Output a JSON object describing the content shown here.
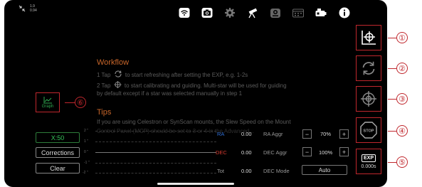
{
  "status": {
    "line1": "1.9",
    "line2": "0.94"
  },
  "topbar_icons": [
    "wifi-icon",
    "camera-icon",
    "gear-icon",
    "telescope-icon",
    "guide-camera-icon",
    "calendar-icon",
    "focuser-icon",
    "info-icon"
  ],
  "workflow": {
    "title": "Workflow",
    "step1_pre": "1 Tap",
    "step1_post": "to start refreshing after setting the EXP, e.g. 1-2s",
    "step2_pre": "2 Tap",
    "step2_post": "to start calibrating and guiding. Multi-star will be used for guiding",
    "step2_line2": "by default except if a star was selected manually in step 1"
  },
  "tips": {
    "title": "Tips",
    "line1": "If you are using Celestron or SynScan mounts, the Slew Speed on the Mount",
    "line2": "Control Panel (MCP) should be set to 3 or 4 in the Advanced..."
  },
  "graph_button": {
    "label": "Graph"
  },
  "left_buttons": {
    "x_scale": "X:50",
    "corrections": "Corrections",
    "clear": "Clear"
  },
  "graph": {
    "y_labels": [
      "2 ''",
      "1 ''",
      "0 ''",
      "-1 ''",
      "-2 ''"
    ]
  },
  "stats": {
    "ra_label": "RA",
    "ra_value": "0.00",
    "dec_label": "DEC",
    "dec_value": "0.00",
    "tot_label": "Tot",
    "tot_value": "0.00"
  },
  "settings": {
    "ra_aggr_label": "RA Aggr",
    "ra_aggr_value": "70%",
    "dec_aggr_label": "DEC Aggr",
    "dec_aggr_value": "100%",
    "dec_mode_label": "DEC Mode",
    "dec_mode_value": "Auto",
    "minus": "−",
    "plus": "+"
  },
  "exposure": {
    "badge": "EXP",
    "value": "0.000s"
  },
  "stop_label": "STOP",
  "callouts": [
    "①",
    "②",
    "③",
    "④",
    "⑤",
    "⑥"
  ],
  "colors": {
    "accent": "#c0272d",
    "title": "#c8662a",
    "ra": "#2f6fd6",
    "dec": "#d63a2f",
    "green": "#2fa84f"
  }
}
